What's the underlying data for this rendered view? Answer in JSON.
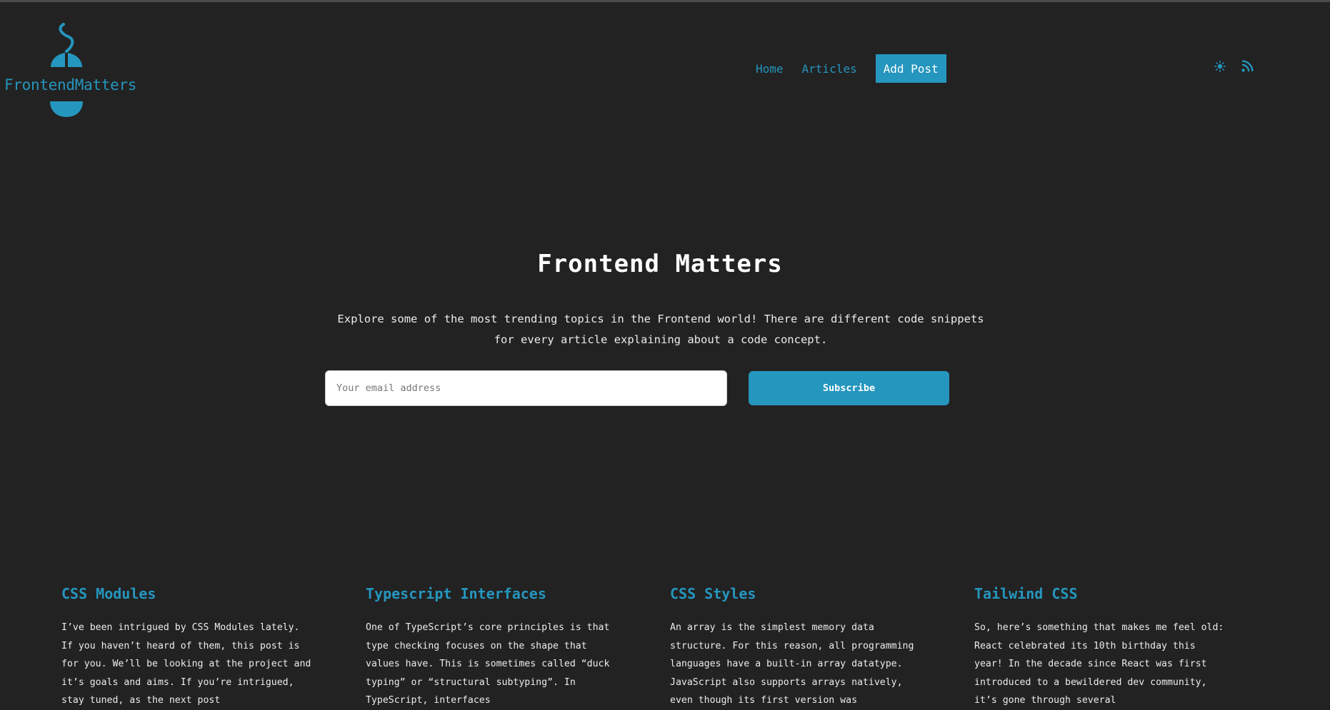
{
  "brand": {
    "name": "FrontendMatters"
  },
  "nav": {
    "home": "Home",
    "articles": "Articles",
    "add_post": "Add Post"
  },
  "icons": [
    "theme-toggle-sun-icon",
    "rss-feed-icon"
  ],
  "hero": {
    "title": "Frontend Matters",
    "description": "Explore some of the most trending topics in the Frontend world! There are different code snippets for every article explaining about a code concept.",
    "email_placeholder": "Your email address",
    "subscribe_label": "Subscribe"
  },
  "articles": [
    {
      "title": "CSS Modules",
      "excerpt": "I’ve been intrigued by CSS Modules lately. If you haven’t heard of them, this post is for you. We’ll be looking at the project and it’s goals and aims. If you’re intrigued, stay tuned, as the next post"
    },
    {
      "title": "Typescript Interfaces",
      "excerpt": "One of TypeScript’s core principles is that type checking focuses on the shape that values have. This is sometimes called “duck typing” or “structural subtyping”. In TypeScript, interfaces"
    },
    {
      "title": "CSS Styles",
      "excerpt": "An array is the simplest memory data structure. For this reason, all programming languages have a built-in array datatype. JavaScript also supports arrays natively, even though its first version was"
    },
    {
      "title": "Tailwind CSS",
      "excerpt": "So, here’s something that makes me feel old: React celebrated its 10th birthday this year! In the decade since React was first introduced to a bewildered dev community, it’s gone through several"
    }
  ],
  "colors": {
    "accent": "#2596be",
    "background": "#222222",
    "text": "#ececec"
  }
}
